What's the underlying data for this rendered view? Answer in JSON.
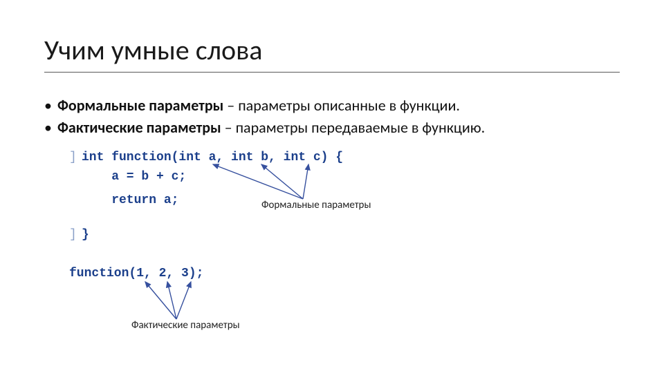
{
  "title": "Учим умные слова",
  "bullets": [
    {
      "term": "Формальные параметры",
      "desc": " – параметры описанные в функции."
    },
    {
      "term": "Фактические параметры",
      "desc": " – параметры передаваемые в функцию."
    }
  ],
  "code": {
    "l1_margin": "]",
    "l1": "int function(int a, int b, int c) {",
    "l2": "    a = b + c;",
    "l3": "    return a;",
    "l5_margin": "]",
    "l5": "}",
    "l6": "function(1, 2, 3);"
  },
  "labels": {
    "formal": "Формальные параметры",
    "actual": "Фактические параметры"
  },
  "colors": {
    "code": "#1b3f8b",
    "arrow": "#36509e"
  }
}
